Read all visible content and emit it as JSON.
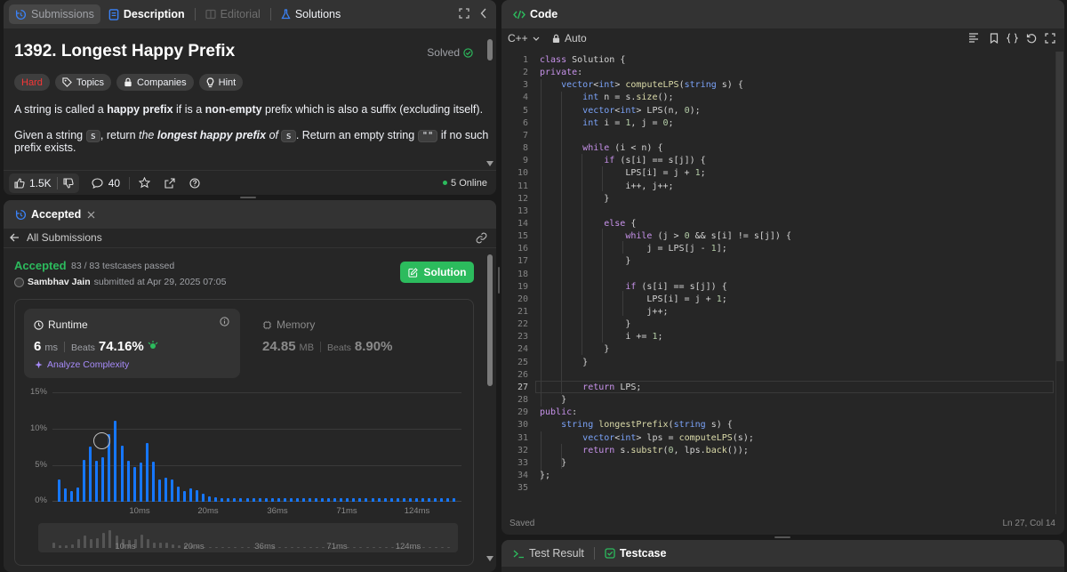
{
  "left_top": {
    "tabs": [
      "Submissions",
      "Description",
      "Editorial",
      "Solutions"
    ],
    "title": "1392. Longest Happy Prefix",
    "solved": "Solved",
    "tags": [
      "Hard",
      "Topics",
      "Companies",
      "Hint"
    ],
    "desc1": {
      "a": "A string is called a ",
      "b": "happy prefix",
      "c": " if is a ",
      "d": "non-empty",
      "e": " prefix which is also a suffix (excluding itself)."
    },
    "desc2": {
      "a": "Given a string ",
      "code1": "s",
      "b": ", return ",
      "c": "the ",
      "d": "longest happy prefix",
      "e": " of ",
      "code2": "s",
      "f": ". Return an empty string ",
      "code3": "\"\"",
      "g": " if no such prefix exists."
    },
    "likes": "1.5K",
    "comments": "40",
    "online": "5 Online"
  },
  "left_bottom": {
    "tab": "Accepted",
    "back": "All Submissions",
    "status": "Accepted",
    "passed": "83 / 83 testcases passed",
    "user": "Sambhav Jain",
    "submitted": "submitted at Apr 29, 2025 07:05",
    "solution_btn": "Solution",
    "runtime": {
      "label": "Runtime",
      "value": "6",
      "unit": "ms",
      "beats_label": "Beats",
      "beats": "74.16%",
      "analyze": "Analyze Complexity"
    },
    "memory": {
      "label": "Memory",
      "value": "24.85",
      "unit": "MB",
      "beats_label": "Beats",
      "beats": "8.90%"
    }
  },
  "chart_data": {
    "type": "bar",
    "yticks": [
      "15%",
      "10%",
      "5%",
      "0%"
    ],
    "ylim": [
      0,
      15
    ],
    "xticks": [
      "10ms",
      "20ms",
      "36ms",
      "71ms",
      "124ms"
    ],
    "values": [
      3.1,
      1.8,
      1.5,
      2.0,
      5.8,
      7.6,
      5.6,
      6.2,
      9.4,
      11.2,
      7.8,
      5.6,
      4.8,
      5.4,
      8.1,
      5.5,
      3.1,
      3.3,
      3.1,
      2.1,
      1.5,
      1.8,
      1.6,
      1.1,
      0.8,
      0.6,
      0.5,
      0.5,
      0.5,
      0.5,
      0.5,
      0.5,
      0.5,
      0.5,
      0.5,
      0.5,
      0.5,
      0.5,
      0.5,
      0.5,
      0.5,
      0.5,
      0.5,
      0.5,
      0.5,
      0.5,
      0.5,
      0.5,
      0.5,
      0.5,
      0.5,
      0.5,
      0.5,
      0.5,
      0.5,
      0.5,
      0.5,
      0.5,
      0.5,
      0.5,
      0.5,
      0.5,
      0.5,
      0.5
    ],
    "highlight_index": 7
  },
  "code": {
    "title": "Code",
    "lang": "C++",
    "mode": "Auto",
    "saved": "Saved",
    "cursor": "Ln 27, Col 14",
    "lines": [
      "class Solution {",
      "private:",
      "    vector<int> computeLPS(string s) {",
      "        int n = s.size();",
      "        vector<int> LPS(n, 0);",
      "        int i = 1, j = 0;",
      "",
      "        while (i < n) {",
      "            if (s[i] == s[j]) {",
      "                LPS[i] = j + 1;",
      "                i++, j++;",
      "            }",
      "",
      "            else {",
      "                while (j > 0 && s[i] != s[j]) {",
      "                    j = LPS[j - 1];",
      "                }",
      "",
      "                if (s[i] == s[j]) {",
      "                    LPS[i] = j + 1;",
      "                    j++;",
      "                }",
      "                i += 1;",
      "            }",
      "        }",
      "",
      "        return LPS;",
      "    }",
      "public:",
      "    string longestPrefix(string s) {",
      "        vector<int> lps = computeLPS(s);",
      "        return s.substr(0, lps.back());",
      "    }",
      "};",
      ""
    ]
  },
  "bottom_right": {
    "test_result": "Test Result",
    "testcase": "Testcase"
  }
}
